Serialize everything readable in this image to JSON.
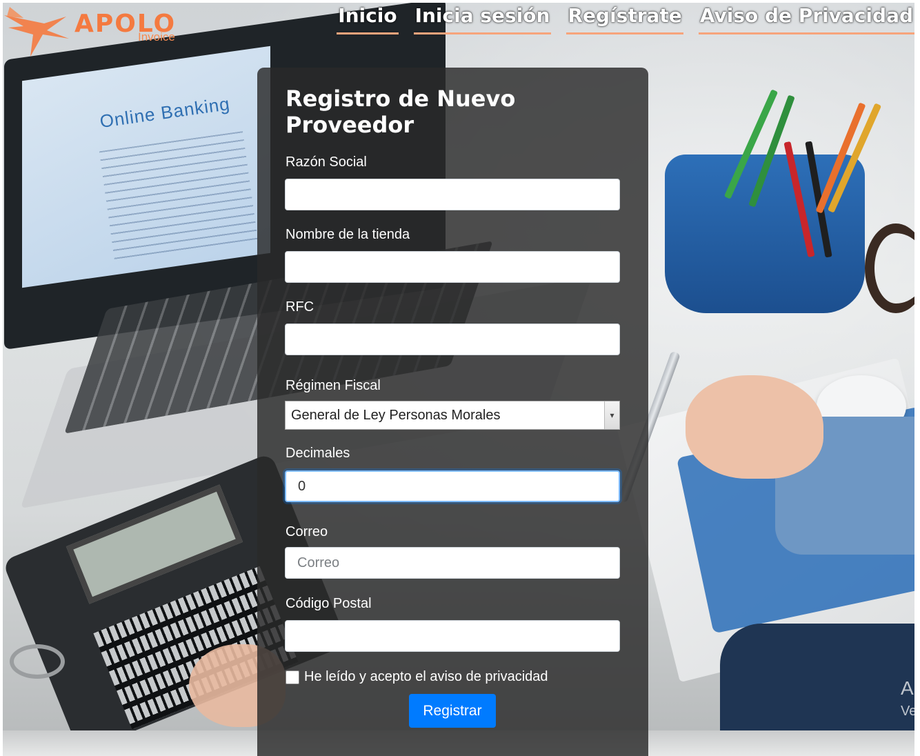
{
  "logo": {
    "name": "APOLO",
    "sub": "Invoice"
  },
  "nav": {
    "items": [
      {
        "label": "Inicio"
      },
      {
        "label": "Inicia sesión"
      },
      {
        "label": "Regístrate"
      },
      {
        "label": "Aviso de Privacidad"
      }
    ]
  },
  "background": {
    "screen_text": "Online Banking",
    "corner_a": "A",
    "corner_b": "Ve"
  },
  "form": {
    "title": "Registro de Nuevo Proveedor",
    "razon_social": {
      "label": "Razón Social",
      "value": ""
    },
    "nombre_tienda": {
      "label": "Nombre de la tienda",
      "value": ""
    },
    "rfc": {
      "label": "RFC",
      "value": ""
    },
    "regimen": {
      "label": "Régimen Fiscal",
      "selected": "General de Ley Personas Morales"
    },
    "decimales": {
      "label": "Decimales",
      "value": "0"
    },
    "correo": {
      "label": "Correo",
      "placeholder": "Correo",
      "value": ""
    },
    "codigo_postal": {
      "label": "Código Postal",
      "value": ""
    },
    "privacy_check": {
      "label": "He leído y acepto el aviso de privacidad",
      "checked": false
    },
    "submit_label": "Registrar"
  },
  "colors": {
    "brand_orange": "#f47a40",
    "button_blue": "#007bff",
    "panel_dark": "#2a2a2a"
  }
}
